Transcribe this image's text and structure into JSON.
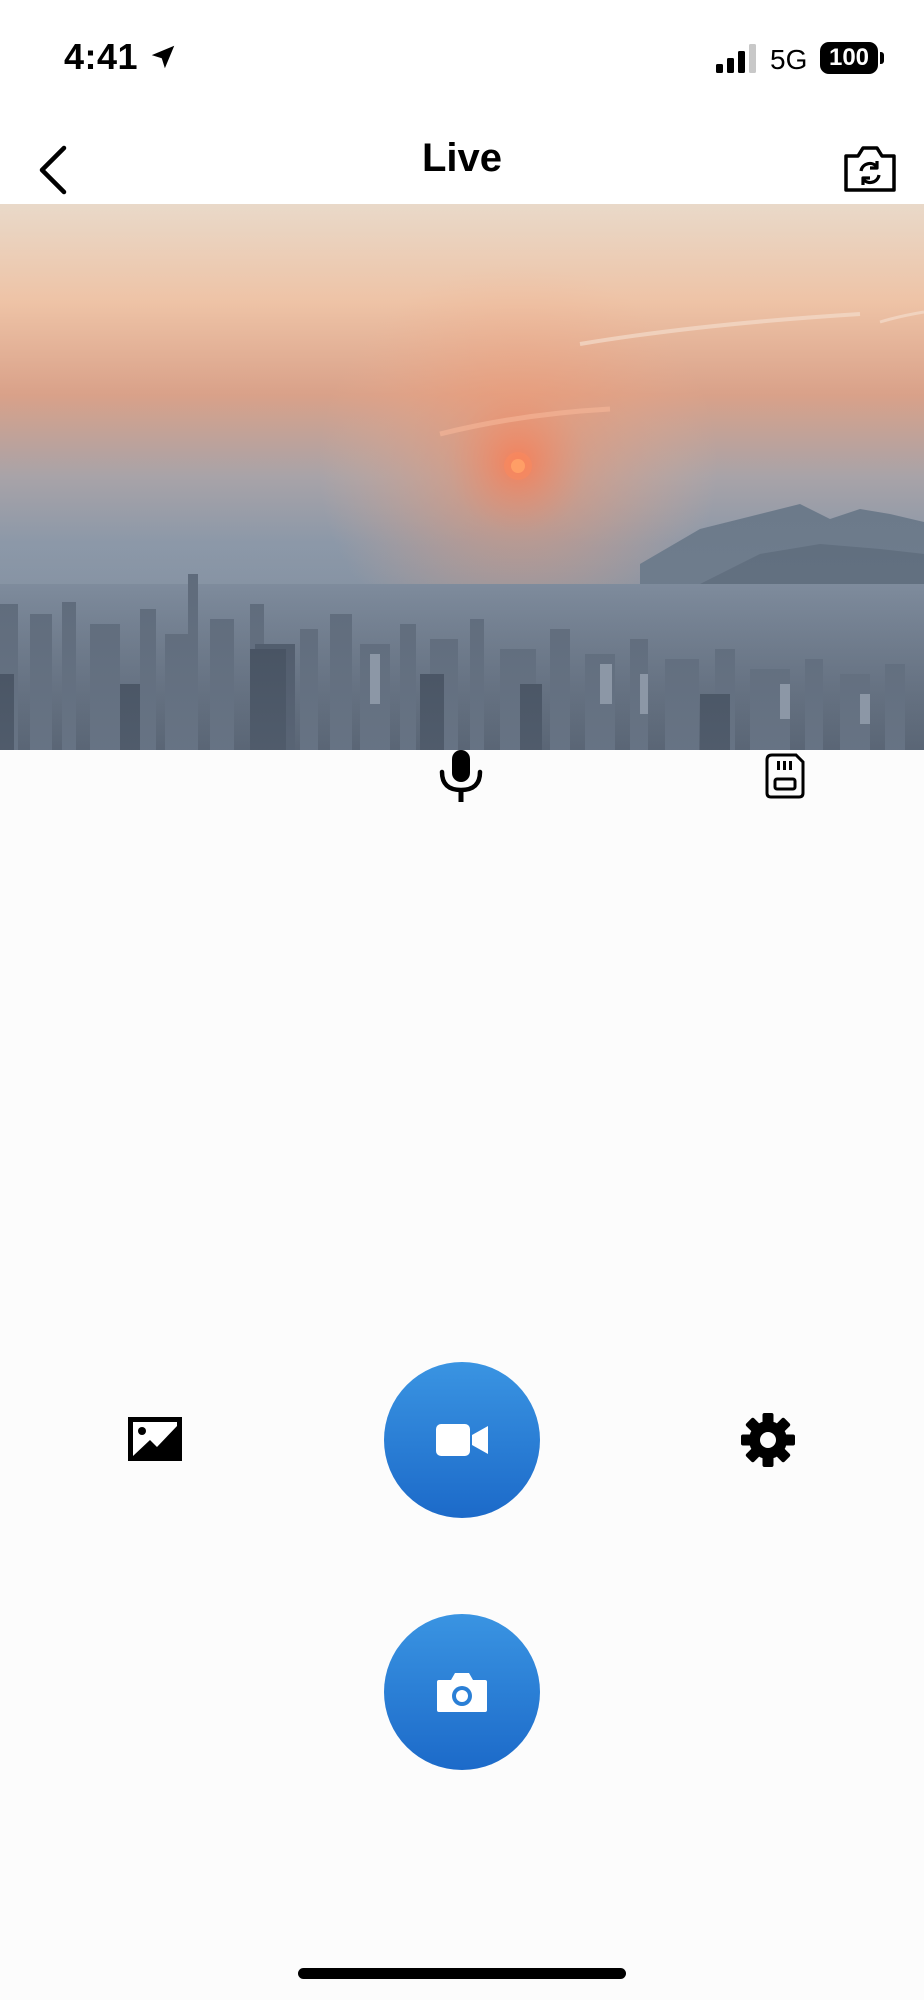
{
  "status_bar": {
    "time": "4:41",
    "network": "5G",
    "battery": "100",
    "icons": [
      "location-arrow-icon",
      "cellular-signal-icon",
      "battery-icon"
    ]
  },
  "header": {
    "title": "Live",
    "back_icon": "chevron-left-icon",
    "switch_camera_icon": "camera-switch-icon"
  },
  "live_view": {
    "description_icon": "live-camera-feed"
  },
  "controls": {
    "mic_icon": "microphone-icon",
    "sd_card_icon": "sd-card-icon",
    "gallery_icon": "image-gallery-icon",
    "record_icon": "video-camera-icon",
    "settings_icon": "gear-icon",
    "snapshot_icon": "camera-icon"
  },
  "colors": {
    "accent_blue": "#2a7fd6",
    "background": "#fcfcfc"
  }
}
